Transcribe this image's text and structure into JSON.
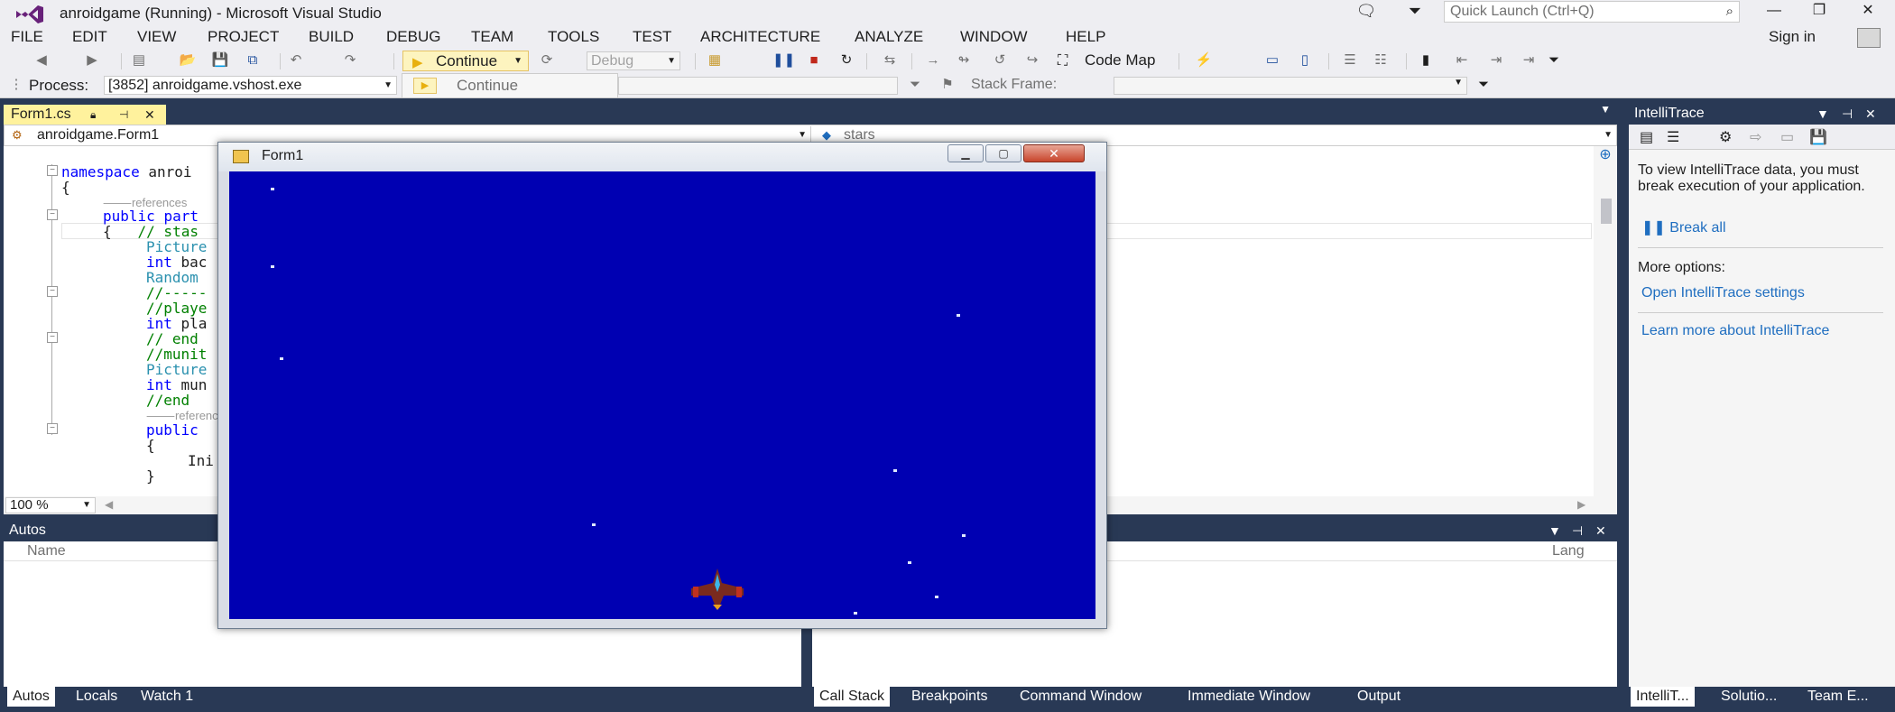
{
  "window": {
    "title": "anroidgame (Running) - Microsoft Visual Studio",
    "quick_launch_placeholder": "Quick Launch (Ctrl+Q)",
    "sign_in": "Sign in"
  },
  "menu": [
    "FILE",
    "EDIT",
    "VIEW",
    "PROJECT",
    "BUILD",
    "DEBUG",
    "TEAM",
    "TOOLS",
    "TEST",
    "ARCHITECTURE",
    "ANALYZE",
    "WINDOW",
    "HELP"
  ],
  "toolbar": {
    "continue_label": "Continue",
    "config": "Debug",
    "code_map": "Code Map"
  },
  "debug_location": {
    "process_label": "Process:",
    "process_value": "[3852] anroidgame.vshost.exe",
    "continue_tooltip": "Continue",
    "stack_frame_label": "Stack Frame:"
  },
  "editor": {
    "tab": "Form1.cs",
    "nav_class": "anroidgame.Form1",
    "nav_member": "stars",
    "zoom": "100 %",
    "code": [
      "namespace anroi",
      "{",
      "references",
      "public part",
      "{   // stas",
      "Picture",
      "int bac",
      "Random",
      "//-----",
      "//playe",
      "int pla",
      "// end",
      "//munit",
      "Picture",
      "int mun",
      "//end",
      "reference",
      "public",
      "{",
      "Ini",
      "}"
    ]
  },
  "autos": {
    "title": "Autos",
    "col_name": "Name",
    "tabs": [
      "Autos",
      "Locals",
      "Watch 1"
    ]
  },
  "callstack": {
    "col_lang": "Lang",
    "tabs": [
      "Call Stack",
      "Breakpoints",
      "Command Window",
      "Immediate Window",
      "Output"
    ]
  },
  "intellitrace": {
    "title": "IntelliTrace",
    "message": "To view IntelliTrace data, you must break execution of your application.",
    "break_all": "Break all",
    "more_options": "More options:",
    "open_settings": "Open IntelliTrace settings",
    "learn_more": "Learn more about IntelliTrace",
    "tabs": [
      "IntelliT...",
      "Solutio...",
      "Team E..."
    ]
  },
  "form1": {
    "title": "Form1",
    "background": "#0000b2"
  },
  "colors": {
    "accent": "#293955",
    "active_tab": "#fff29d",
    "link": "#1f6ec0"
  }
}
